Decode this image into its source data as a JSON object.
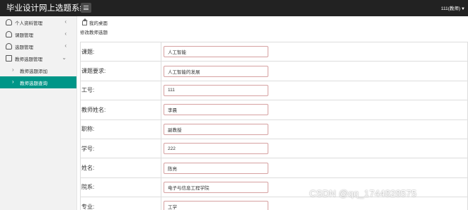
{
  "header": {
    "app_title": "毕业设计网上选题系统",
    "user_label": "111(教师)",
    "user_caret": "▼"
  },
  "sidebar": {
    "items": [
      {
        "label": "个人资料管理",
        "icon": "user-icon",
        "chevron": "‹"
      },
      {
        "label": "课题管理",
        "icon": "user-icon",
        "chevron": "‹"
      },
      {
        "label": "选题管理",
        "icon": "user-icon",
        "chevron": "‹"
      },
      {
        "label": "教师选题管理",
        "icon": "document-icon",
        "chevron": "⌄"
      },
      {
        "label": "教师选题添加",
        "chevron": "›"
      },
      {
        "label": "教师选题查询",
        "chevron": "›",
        "active": true
      }
    ]
  },
  "breadcrumb": {
    "label": "我的桌面"
  },
  "form": {
    "title": "修改教师选题",
    "fields": [
      {
        "label": "课题:",
        "value": "人工智能"
      },
      {
        "label": "课题要求:",
        "value": "人工智能的发展"
      },
      {
        "label": "工号:",
        "value": "111"
      },
      {
        "label": "教师姓名:",
        "value": "李晨"
      },
      {
        "label": "职称:",
        "value": "副教授"
      },
      {
        "label": "学号:",
        "value": "222"
      },
      {
        "label": "姓名:",
        "value": "陈亮"
      },
      {
        "label": "院系:",
        "value": "电子与信息工程学院"
      },
      {
        "label": "专业:",
        "value": "工学"
      }
    ]
  },
  "watermark": "CSDN @qq_1744828575",
  "colors": {
    "topbar": "#222222",
    "sidebar_bg": "#f2f2f2",
    "active_item": "#009688",
    "field_border": "#d6a1a1"
  }
}
